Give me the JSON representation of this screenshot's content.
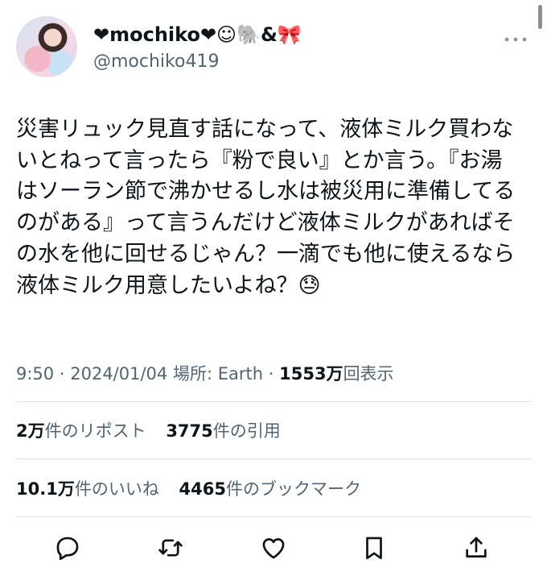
{
  "user": {
    "display_name": "❤mochiko❤☺🐘&🎀",
    "handle": "@mochiko419"
  },
  "tweet": {
    "text": "災害リュック見直す話になって、液体ミルク買わな\nいとねって言ったら『粉で良い』とか言う。『お湯\nはソーラン節で沸かせるし水は被災用に準備してる\nのがある』って言うんだけど液体ミルクがあればそ\nの水を他に回せるじゃん？一滴でも他に使えるなら\n液体ミルク用意したいよね？😓"
  },
  "meta": {
    "time": "9:50",
    "separator": "·",
    "date": "2024/01/04",
    "location": "場所: Earth",
    "views_count": "1553万",
    "views_label": "回表示"
  },
  "stats": {
    "reposts_count": "2万",
    "reposts_label": "件のリポスト",
    "quotes_count": "3775",
    "quotes_label": "件の引用",
    "likes_count": "10.1万",
    "likes_label": "件のいいね",
    "bookmarks_count": "4465",
    "bookmarks_label": "件のブックマーク"
  },
  "icons": [
    "more-icon",
    "reply-icon",
    "repost-icon",
    "like-icon",
    "bookmark-icon",
    "share-icon"
  ],
  "colors": {
    "text": "#0f1419",
    "muted": "#536471",
    "divider": "#e1e5e8"
  }
}
